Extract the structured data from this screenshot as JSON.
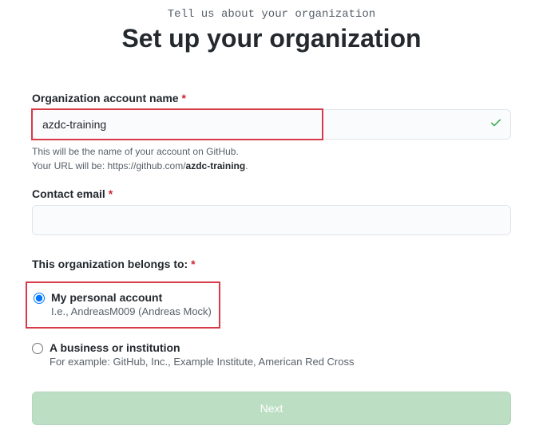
{
  "header": {
    "subtitle": "Tell us about your organization",
    "title": "Set up your organization"
  },
  "org_name": {
    "label": "Organization account name",
    "value": "azdc-training",
    "hint_prefix": "This will be the name of your account on GitHub.",
    "hint_url_prefix": "Your URL will be: https://github.com/",
    "hint_url_slug": "azdc-training",
    "hint_url_suffix": "."
  },
  "contact_email": {
    "label": "Contact email",
    "value": ""
  },
  "belongs_to": {
    "label": "This organization belongs to:",
    "options": [
      {
        "label": "My personal account",
        "hint": "I.e., AndreasM009 (Andreas Mock)",
        "selected": true
      },
      {
        "label": "A business or institution",
        "hint": "For example: GitHub, Inc., Example Institute, American Red Cross",
        "selected": false
      }
    ]
  },
  "next_button": {
    "label": "Next"
  },
  "required_marker": "*"
}
